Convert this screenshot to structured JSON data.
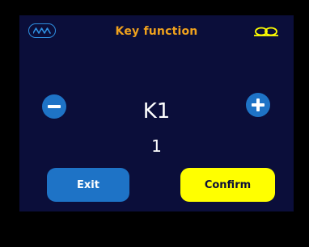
{
  "header": {
    "title": "Key function",
    "left_icon": "wave-icon",
    "right_icon": "glasses-icon"
  },
  "selector": {
    "decrement_icon": "minus-icon",
    "increment_icon": "plus-icon",
    "key_label": "K1",
    "value": "1"
  },
  "actions": {
    "exit_label": "Exit",
    "confirm_label": "Confirm"
  },
  "colors": {
    "screen_background": "#0b0e3a",
    "title": "#f0a21d",
    "accent_blue": "#1e73c6",
    "confirm_yellow": "#ffff00",
    "glasses_icon": "#ffff00",
    "wave_icon": "#2e8fe0"
  }
}
